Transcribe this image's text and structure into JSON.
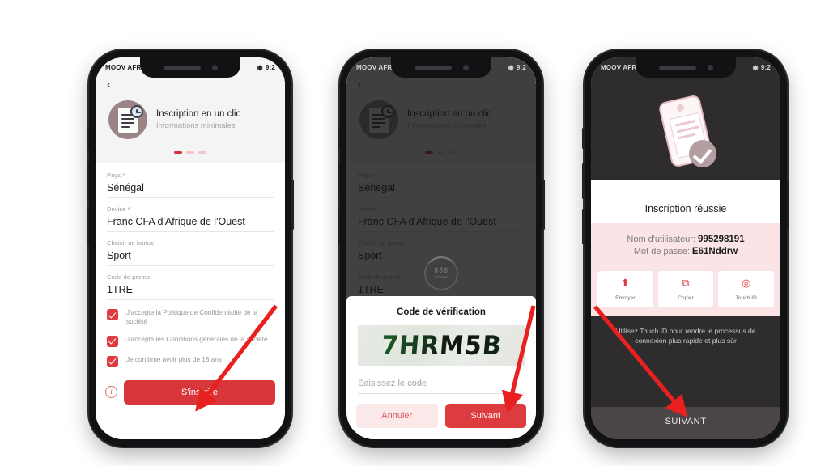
{
  "statusbar": {
    "carrier": "MOOV AFRICA",
    "right": "9:2"
  },
  "screen1": {
    "name": "registration-form",
    "back_icon": "‹",
    "promo": {
      "title": "Inscription en un clic",
      "subtitle": "Informations minimales",
      "icon": "document-clock-icon"
    },
    "dots": [
      "active",
      "inactive",
      "inactive"
    ],
    "fields": [
      {
        "label": "Pays *",
        "value": "Sénégal"
      },
      {
        "label": "Devise *",
        "value": "Franc CFA d'Afrique de l'Ouest"
      },
      {
        "label": "Choisir un bonus",
        "value": "Sport"
      },
      {
        "label": "Code de promo",
        "value": "1TRE"
      }
    ],
    "checkboxes": [
      {
        "text": "J'accepte la Politique de Confidentialité de la société",
        "checked": true
      },
      {
        "text": "J'accepte les Conditions générales de la société",
        "checked": true
      },
      {
        "text": "Je confirme avoir plus de 18 ans",
        "checked": true
      }
    ],
    "info_icon": "i",
    "submit_label": "S'inscrire"
  },
  "screen2": {
    "name": "verification-code-sheet",
    "spinner": {
      "logo_top": "888",
      "logo_bottom": "STARZ"
    },
    "sheet_title": "Code de vérification",
    "captcha_code": "7HRM5B",
    "input_placeholder": "Saisissez le code",
    "cancel_label": "Annuler",
    "next_label": "Suivant"
  },
  "screen3": {
    "name": "registration-success",
    "title": "Inscription réussie",
    "credentials": [
      {
        "label": "Nom d'utilisateur:",
        "value": "995298191"
      },
      {
        "label": "Mot de passe:",
        "value": "E61Nddrw"
      }
    ],
    "actions": [
      {
        "label": "Envoyer",
        "icon": "share-icon",
        "glyph": "⬆"
      },
      {
        "label": "Copier",
        "icon": "copy-icon",
        "glyph": "⧉"
      },
      {
        "label": "Touch ID",
        "icon": "fingerprint-icon",
        "glyph": "◎"
      }
    ],
    "hint": "Utilisez Touch ID pour rendre le processus de connexion plus rapide et plus sûr",
    "next_label": "SUIVANT"
  },
  "colors": {
    "brand_red": "#dd3b40",
    "button_red": "#d8363b",
    "pink_bg": "#fbe4e6",
    "arrow_red": "#e8201f",
    "page_bg": "#ffffff"
  },
  "annotations": [
    {
      "name": "arrow-to-sinscrire",
      "target": "S'inscrire"
    },
    {
      "name": "arrow-to-suivant",
      "target": "Suivant"
    },
    {
      "name": "arrow-to-suivant-next",
      "target": "SUIVANT"
    }
  ]
}
